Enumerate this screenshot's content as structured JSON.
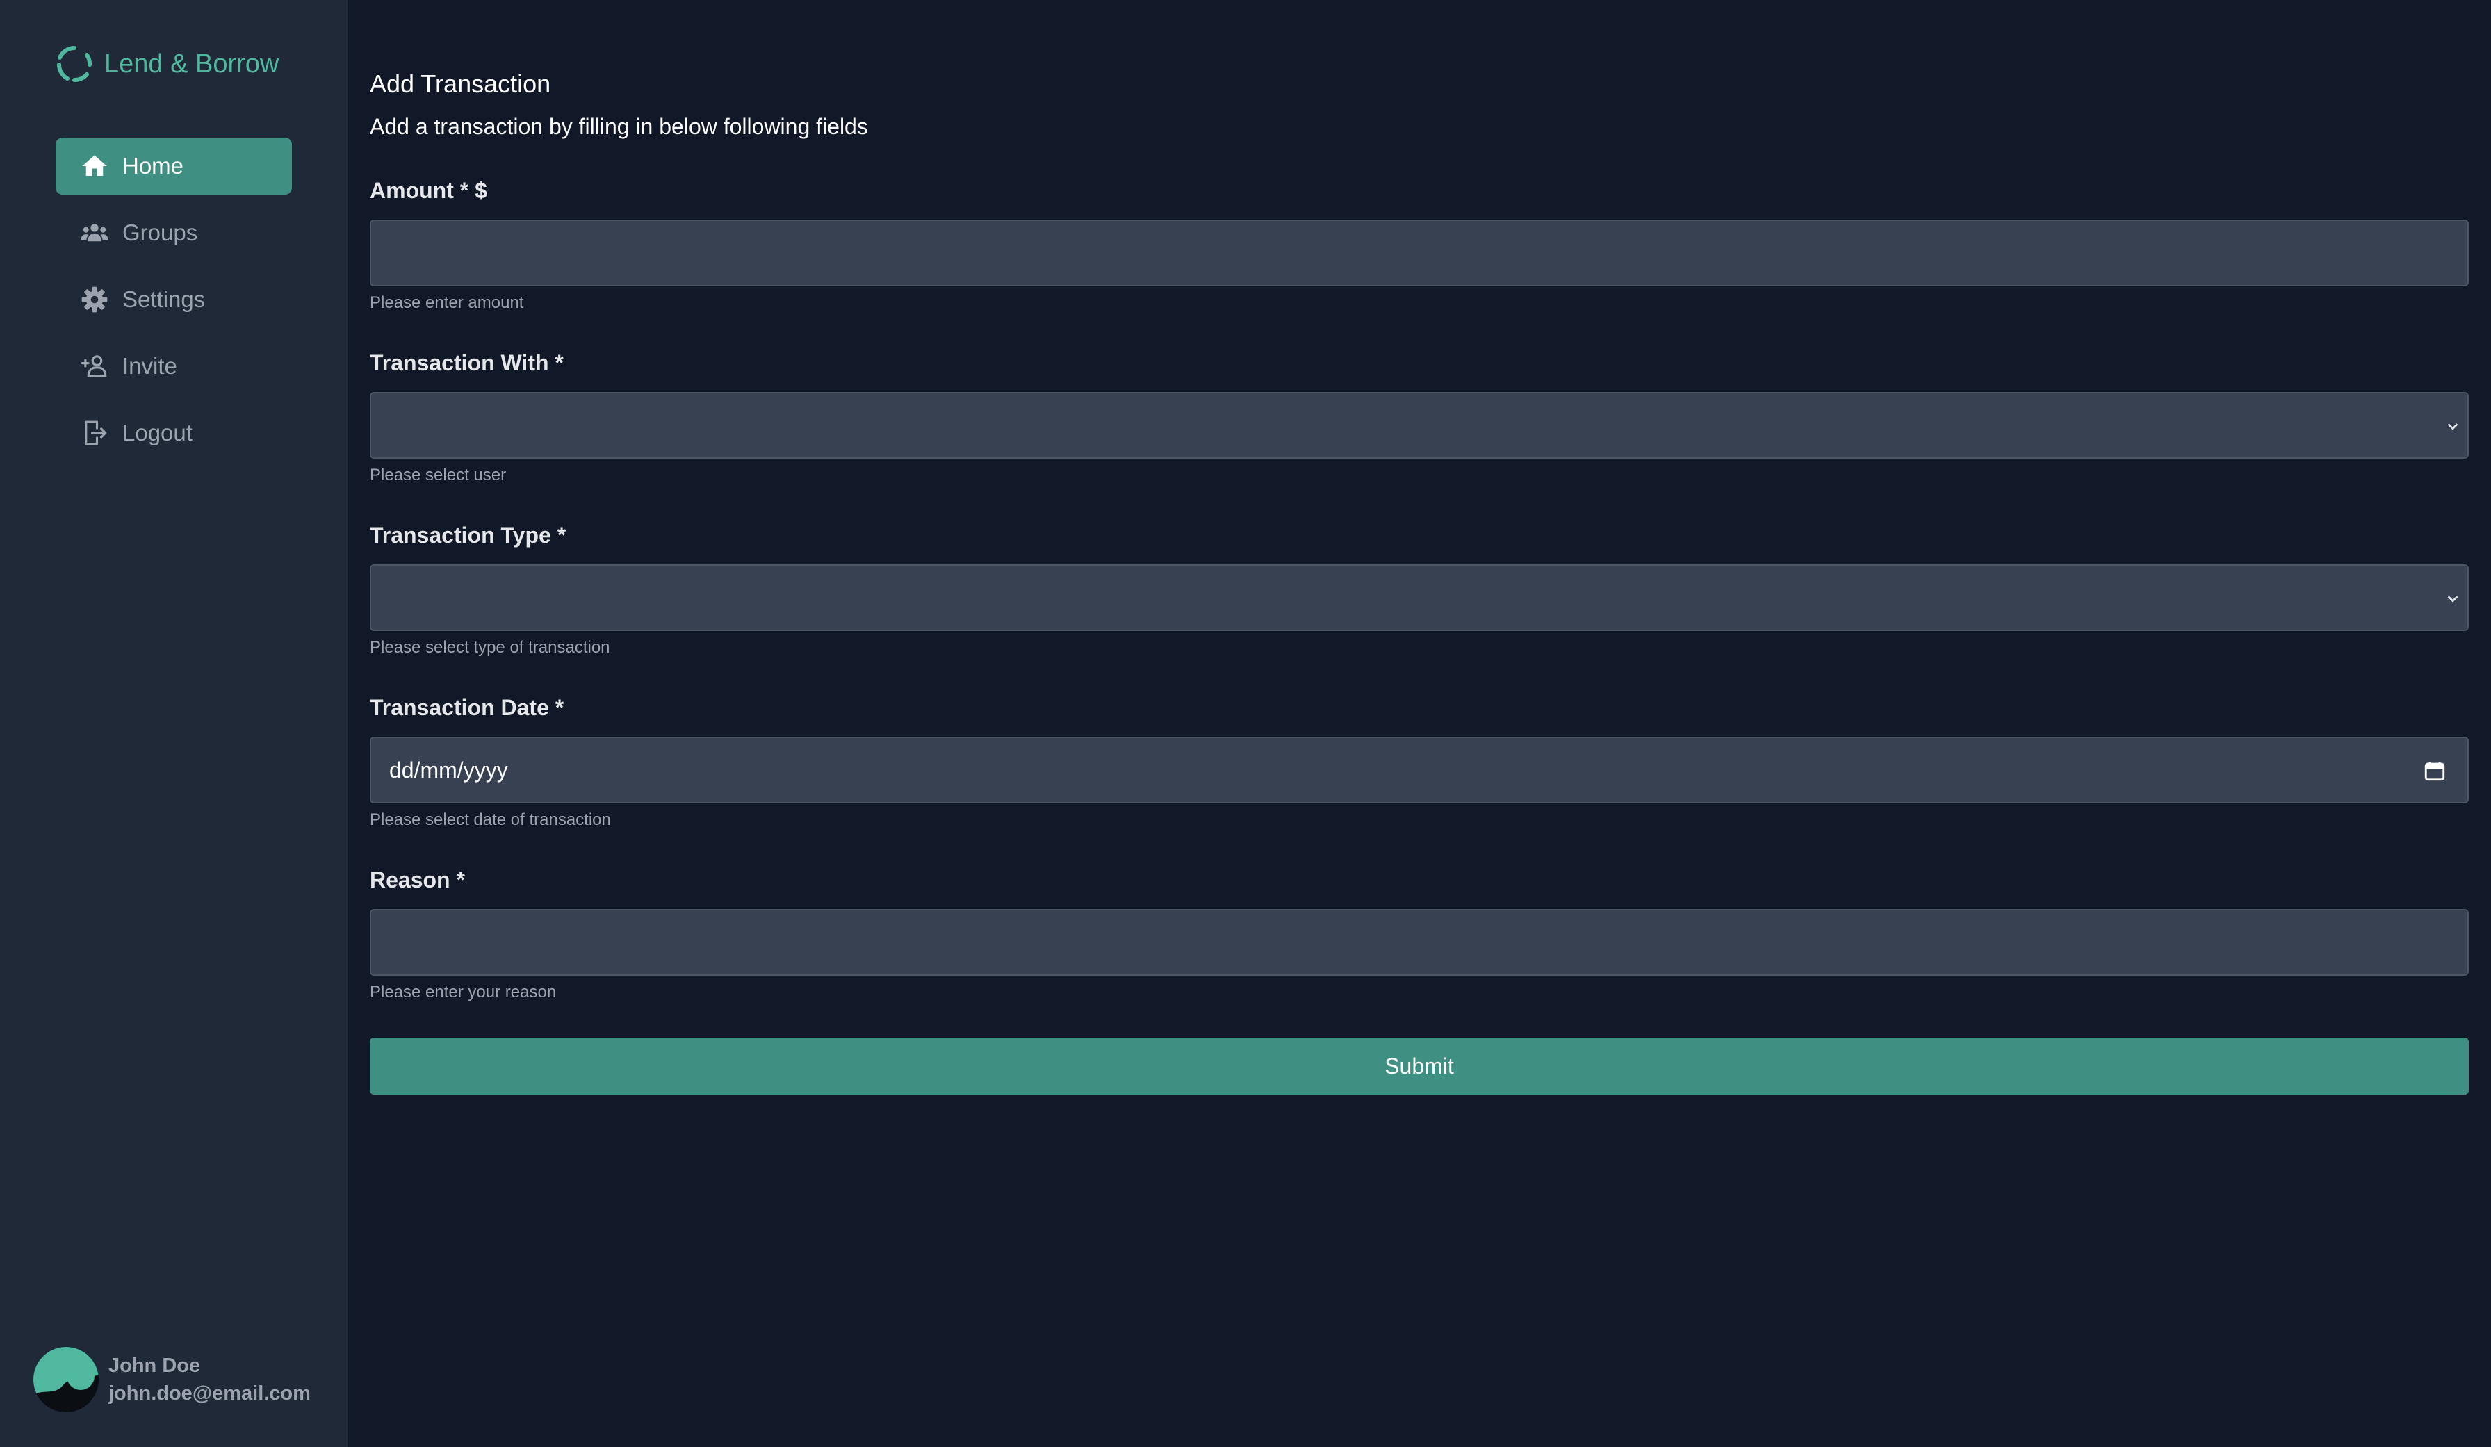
{
  "app": {
    "name": "Lend & Borrow",
    "logo_icon": "spinner-ring-icon",
    "accent_color": "#4fb89e",
    "active_bg_color": "#3f8f82"
  },
  "sidebar": {
    "items": [
      {
        "label": "Home",
        "icon": "home-icon",
        "active": true
      },
      {
        "label": "Groups",
        "icon": "users-icon",
        "active": false
      },
      {
        "label": "Settings",
        "icon": "gear-icon",
        "active": false
      },
      {
        "label": "Invite",
        "icon": "user-plus-icon",
        "active": false
      },
      {
        "label": "Logout",
        "icon": "logout-icon",
        "active": false
      }
    ]
  },
  "user": {
    "name": "John Doe",
    "email": "john.doe@email.com"
  },
  "form": {
    "title": "Add Transaction",
    "subtitle": "Add a transaction by filling in below following fields",
    "amount": {
      "label": "Amount * $",
      "value": "",
      "helper": "Please enter amount"
    },
    "transaction_with": {
      "label": "Transaction With *",
      "selected": "",
      "helper": "Please select user"
    },
    "transaction_type": {
      "label": "Transaction Type *",
      "selected": "",
      "helper": "Please select type of transaction"
    },
    "transaction_date": {
      "label": "Transaction Date *",
      "placeholder": "dd/mm/yyyy",
      "helper": "Please select date of transaction"
    },
    "reason": {
      "label": "Reason *",
      "value": "",
      "helper": "Please enter your reason"
    },
    "submit_label": "Submit"
  }
}
